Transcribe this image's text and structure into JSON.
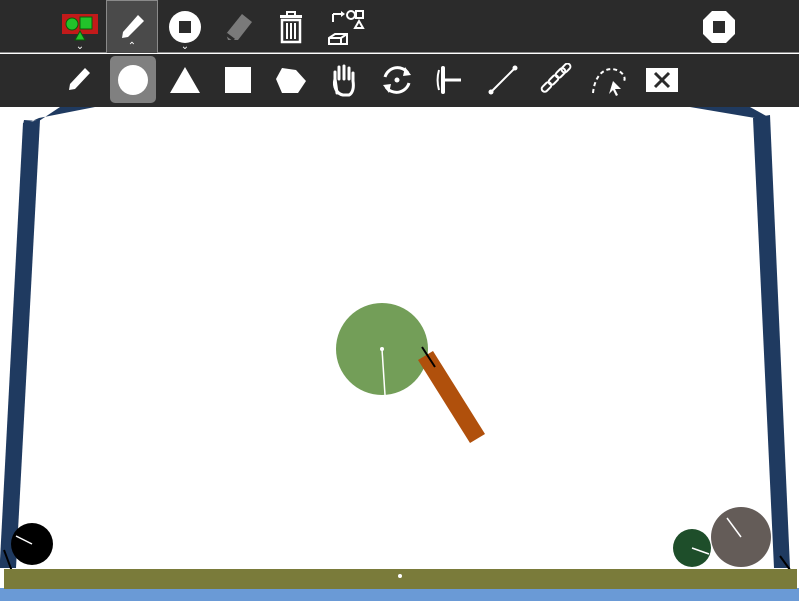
{
  "toolbar_top": {
    "buttons": [
      {
        "name": "scene-mode-icon",
        "caret": "⌄"
      },
      {
        "name": "draw-mode-icon",
        "caret": "⌃",
        "selected": true
      },
      {
        "name": "circle-tool-icon",
        "caret": "⌄"
      },
      {
        "name": "eraser-icon",
        "disabled": true
      },
      {
        "name": "trash-icon"
      },
      {
        "name": "import-export-icon"
      },
      {
        "name": "stop-icon"
      }
    ]
  },
  "toolbar_shapes": {
    "selected": "circle",
    "tools": [
      "pencil",
      "circle",
      "triangle",
      "square",
      "polygon",
      "hand",
      "rotate",
      "fixate",
      "rod",
      "chain",
      "trace",
      "delete"
    ]
  },
  "colors": {
    "toolbar_bg": "#2b2b2b",
    "selected_bg": "#808080",
    "wall": "#1f3a60",
    "ground": "#7a7b3a",
    "water": "#6a9ad6",
    "green_ball": "#739e58",
    "orange_bar": "#b0500c",
    "black_ball": "#000000",
    "dark_green_ball": "#1e4e2a",
    "gray_ball": "#645c58"
  }
}
